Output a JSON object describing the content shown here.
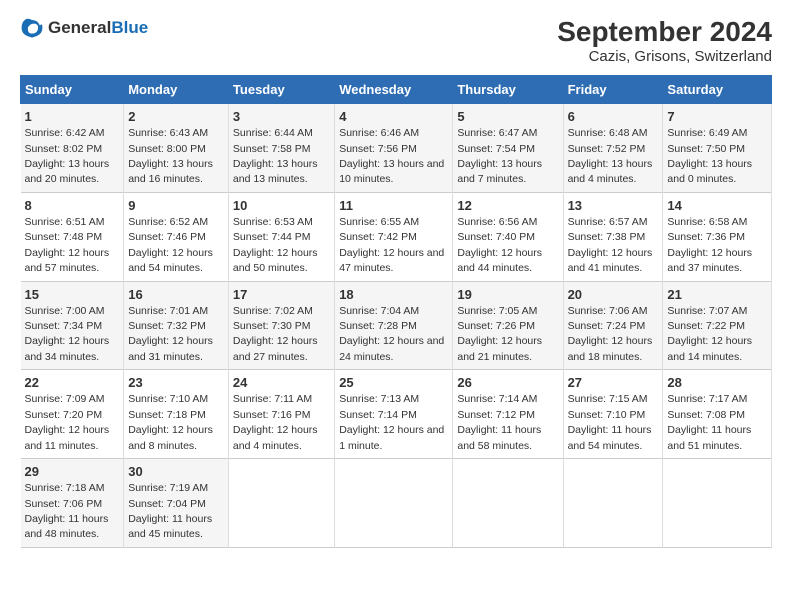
{
  "logo": {
    "general": "General",
    "blue": "Blue"
  },
  "title": "September 2024",
  "subtitle": "Cazis, Grisons, Switzerland",
  "days_of_week": [
    "Sunday",
    "Monday",
    "Tuesday",
    "Wednesday",
    "Thursday",
    "Friday",
    "Saturday"
  ],
  "weeks": [
    [
      {
        "day": "1",
        "sunrise": "6:42 AM",
        "sunset": "8:02 PM",
        "daylight": "13 hours and 20 minutes."
      },
      {
        "day": "2",
        "sunrise": "6:43 AM",
        "sunset": "8:00 PM",
        "daylight": "13 hours and 16 minutes."
      },
      {
        "day": "3",
        "sunrise": "6:44 AM",
        "sunset": "7:58 PM",
        "daylight": "13 hours and 13 minutes."
      },
      {
        "day": "4",
        "sunrise": "6:46 AM",
        "sunset": "7:56 PM",
        "daylight": "13 hours and 10 minutes."
      },
      {
        "day": "5",
        "sunrise": "6:47 AM",
        "sunset": "7:54 PM",
        "daylight": "13 hours and 7 minutes."
      },
      {
        "day": "6",
        "sunrise": "6:48 AM",
        "sunset": "7:52 PM",
        "daylight": "13 hours and 4 minutes."
      },
      {
        "day": "7",
        "sunrise": "6:49 AM",
        "sunset": "7:50 PM",
        "daylight": "13 hours and 0 minutes."
      }
    ],
    [
      {
        "day": "8",
        "sunrise": "6:51 AM",
        "sunset": "7:48 PM",
        "daylight": "12 hours and 57 minutes."
      },
      {
        "day": "9",
        "sunrise": "6:52 AM",
        "sunset": "7:46 PM",
        "daylight": "12 hours and 54 minutes."
      },
      {
        "day": "10",
        "sunrise": "6:53 AM",
        "sunset": "7:44 PM",
        "daylight": "12 hours and 50 minutes."
      },
      {
        "day": "11",
        "sunrise": "6:55 AM",
        "sunset": "7:42 PM",
        "daylight": "12 hours and 47 minutes."
      },
      {
        "day": "12",
        "sunrise": "6:56 AM",
        "sunset": "7:40 PM",
        "daylight": "12 hours and 44 minutes."
      },
      {
        "day": "13",
        "sunrise": "6:57 AM",
        "sunset": "7:38 PM",
        "daylight": "12 hours and 41 minutes."
      },
      {
        "day": "14",
        "sunrise": "6:58 AM",
        "sunset": "7:36 PM",
        "daylight": "12 hours and 37 minutes."
      }
    ],
    [
      {
        "day": "15",
        "sunrise": "7:00 AM",
        "sunset": "7:34 PM",
        "daylight": "12 hours and 34 minutes."
      },
      {
        "day": "16",
        "sunrise": "7:01 AM",
        "sunset": "7:32 PM",
        "daylight": "12 hours and 31 minutes."
      },
      {
        "day": "17",
        "sunrise": "7:02 AM",
        "sunset": "7:30 PM",
        "daylight": "12 hours and 27 minutes."
      },
      {
        "day": "18",
        "sunrise": "7:04 AM",
        "sunset": "7:28 PM",
        "daylight": "12 hours and 24 minutes."
      },
      {
        "day": "19",
        "sunrise": "7:05 AM",
        "sunset": "7:26 PM",
        "daylight": "12 hours and 21 minutes."
      },
      {
        "day": "20",
        "sunrise": "7:06 AM",
        "sunset": "7:24 PM",
        "daylight": "12 hours and 18 minutes."
      },
      {
        "day": "21",
        "sunrise": "7:07 AM",
        "sunset": "7:22 PM",
        "daylight": "12 hours and 14 minutes."
      }
    ],
    [
      {
        "day": "22",
        "sunrise": "7:09 AM",
        "sunset": "7:20 PM",
        "daylight": "12 hours and 11 minutes."
      },
      {
        "day": "23",
        "sunrise": "7:10 AM",
        "sunset": "7:18 PM",
        "daylight": "12 hours and 8 minutes."
      },
      {
        "day": "24",
        "sunrise": "7:11 AM",
        "sunset": "7:16 PM",
        "daylight": "12 hours and 4 minutes."
      },
      {
        "day": "25",
        "sunrise": "7:13 AM",
        "sunset": "7:14 PM",
        "daylight": "12 hours and 1 minute."
      },
      {
        "day": "26",
        "sunrise": "7:14 AM",
        "sunset": "7:12 PM",
        "daylight": "11 hours and 58 minutes."
      },
      {
        "day": "27",
        "sunrise": "7:15 AM",
        "sunset": "7:10 PM",
        "daylight": "11 hours and 54 minutes."
      },
      {
        "day": "28",
        "sunrise": "7:17 AM",
        "sunset": "7:08 PM",
        "daylight": "11 hours and 51 minutes."
      }
    ],
    [
      {
        "day": "29",
        "sunrise": "7:18 AM",
        "sunset": "7:06 PM",
        "daylight": "11 hours and 48 minutes."
      },
      {
        "day": "30",
        "sunrise": "7:19 AM",
        "sunset": "7:04 PM",
        "daylight": "11 hours and 45 minutes."
      },
      null,
      null,
      null,
      null,
      null
    ]
  ],
  "labels": {
    "sunrise": "Sunrise:",
    "sunset": "Sunset:",
    "daylight": "Daylight:"
  }
}
